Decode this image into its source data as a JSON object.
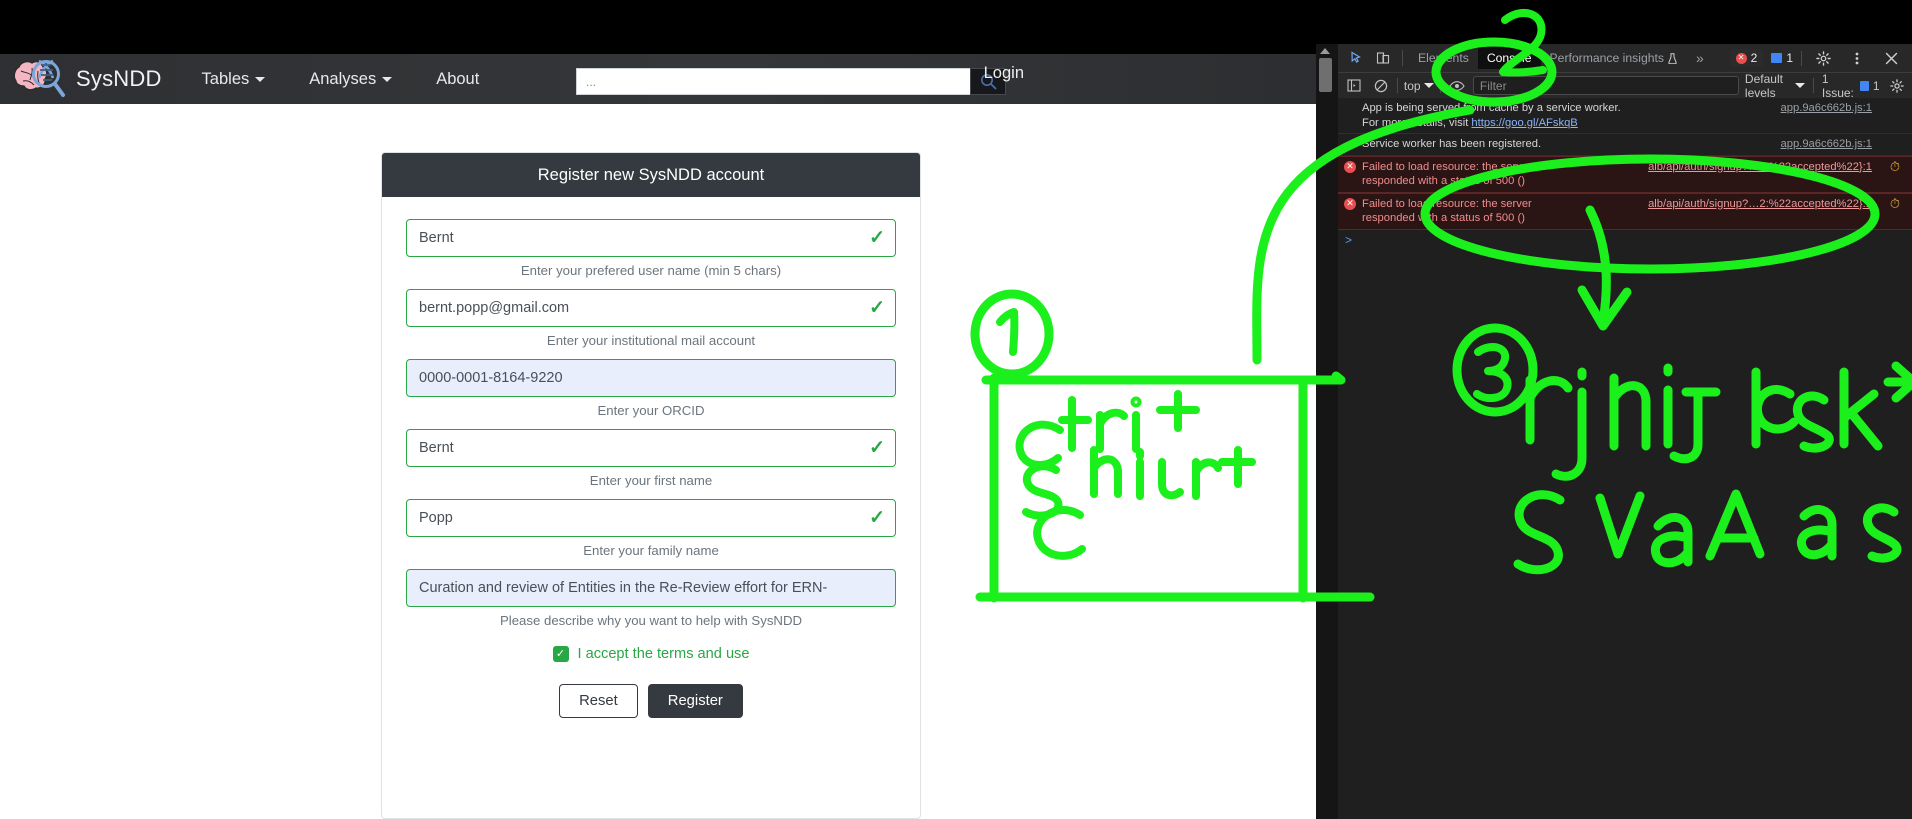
{
  "navbar": {
    "brand": "SysNDD",
    "links": [
      {
        "label": "Tables",
        "has_caret": true
      },
      {
        "label": "Analyses",
        "has_caret": true
      },
      {
        "label": "About",
        "has_caret": false
      }
    ],
    "search_placeholder": "...",
    "search_icon": "search-icon",
    "login_label": "Login"
  },
  "card": {
    "title": "Register new SysNDD account",
    "fields": [
      {
        "name": "username",
        "value": "Bernt",
        "help": "Enter your prefered user name (min 5 chars)",
        "valid": true,
        "focused": false
      },
      {
        "name": "email",
        "value": "bernt.popp@gmail.com",
        "help": "Enter your institutional mail account",
        "valid": true,
        "focused": false
      },
      {
        "name": "orcid",
        "value": "0000-0001-8164-9220",
        "help": "Enter your ORCID",
        "valid": false,
        "focused": true
      },
      {
        "name": "firstname",
        "value": "Bernt",
        "help": "Enter your first name",
        "valid": true,
        "focused": false
      },
      {
        "name": "familyname",
        "value": "Popp",
        "help": "Enter your family name",
        "valid": true,
        "focused": false
      },
      {
        "name": "comment",
        "value": "Curation and review of Entities in the Re-Review effort for ERN-",
        "help": "Please describe why you want to help with SysNDD",
        "valid": false,
        "focused": true
      }
    ],
    "accept_label": "I accept the terms and use",
    "accept_checked": true,
    "reset_label": "Reset",
    "register_label": "Register"
  },
  "devtools": {
    "tabs": [
      {
        "label": "Elements",
        "active": false
      },
      {
        "label": "Console",
        "active": true
      },
      {
        "label": "Performance insights",
        "active": false,
        "badge": "beaker-icon"
      }
    ],
    "overflow_label": "»",
    "error_count": "2",
    "message_count": "1",
    "settings_icon": "gear-icon",
    "kebab_icon": "more-vertical-icon",
    "close_icon": "close-icon",
    "inspect_icon": "inspect-element-icon",
    "device_icon": "device-toolbar-icon",
    "filterbar": {
      "sidebar_icon": "console-sidebar-icon",
      "clear_icon": "clear-console-icon",
      "context": "top",
      "eye_icon": "eye-icon",
      "filter_placeholder": "Filter",
      "levels": "Default levels",
      "issues": "1 Issue:",
      "issues_count": "1",
      "settings_icon": "gear-icon"
    },
    "logs": [
      {
        "type": "info",
        "text": "App is being served from cache by a service worker.",
        "text2_prefix": "For more details, visit ",
        "link": "https://goo.gl/AFskqB",
        "source": "app.9a6c662b.js:1"
      },
      {
        "type": "info",
        "text": "Service worker has been registered.",
        "source": "app.9a6c662b.js:1"
      },
      {
        "type": "error",
        "text": "Failed to load resource: the server",
        "text2": "responded with a status of 500 ()",
        "source": "alb/api/auth/signup?…2:%22accepted%22}:1"
      },
      {
        "type": "error",
        "text": "Failed to load resource: the server",
        "text2": "responded with a status of 500 ()",
        "source": "alb/api/auth/signup?…2:%22accepted%22}:1"
      }
    ]
  },
  "annotations": {
    "color": "#1cf01c",
    "marks": [
      {
        "id": "1",
        "label": "1"
      },
      {
        "id": "2",
        "label": "2"
      },
      {
        "id": "3",
        "label": "3"
      }
    ],
    "texts": [
      {
        "id": "ctrl-shift-c",
        "line1": "ctrl +",
        "line2": "shift +",
        "line3": "c"
      },
      {
        "id": "right-click-save-as",
        "line1": "right click",
        "line2": "save",
        "line3": "as"
      }
    ]
  }
}
